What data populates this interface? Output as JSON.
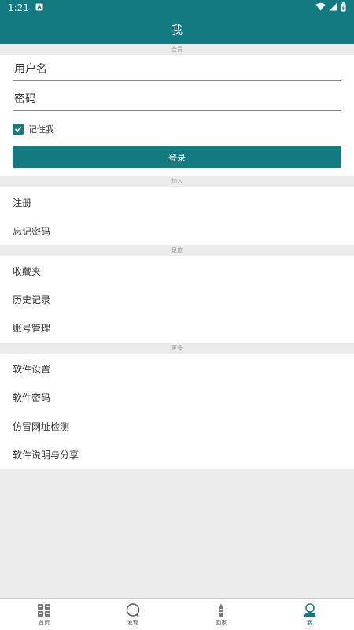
{
  "status_bar": {
    "time": "1:21"
  },
  "app_bar": {
    "title": "我"
  },
  "sections": {
    "member": "会员",
    "join": "加入",
    "footprint": "足迹",
    "more": "更多"
  },
  "login": {
    "username_placeholder": "用户名",
    "password_placeholder": "密码",
    "remember_label": "记住我",
    "login_button": "登录",
    "remember_checked": true
  },
  "join_items": [
    "注册",
    "忘记密码"
  ],
  "footprint_items": [
    "收藏夹",
    "历史记录",
    "账号管理"
  ],
  "more_items": [
    "软件设置",
    "软件密码",
    "仿冒网址检测",
    "软件说明与分享"
  ],
  "bottom_nav": [
    {
      "label": "首页",
      "icon": "grid-icon"
    },
    {
      "label": "发现",
      "icon": "search-icon"
    },
    {
      "label": "回家",
      "icon": "tower-icon"
    },
    {
      "label": "我",
      "icon": "person-icon",
      "active": true
    }
  ],
  "colors": {
    "primary": "#127a80",
    "background": "#ebebeb"
  }
}
